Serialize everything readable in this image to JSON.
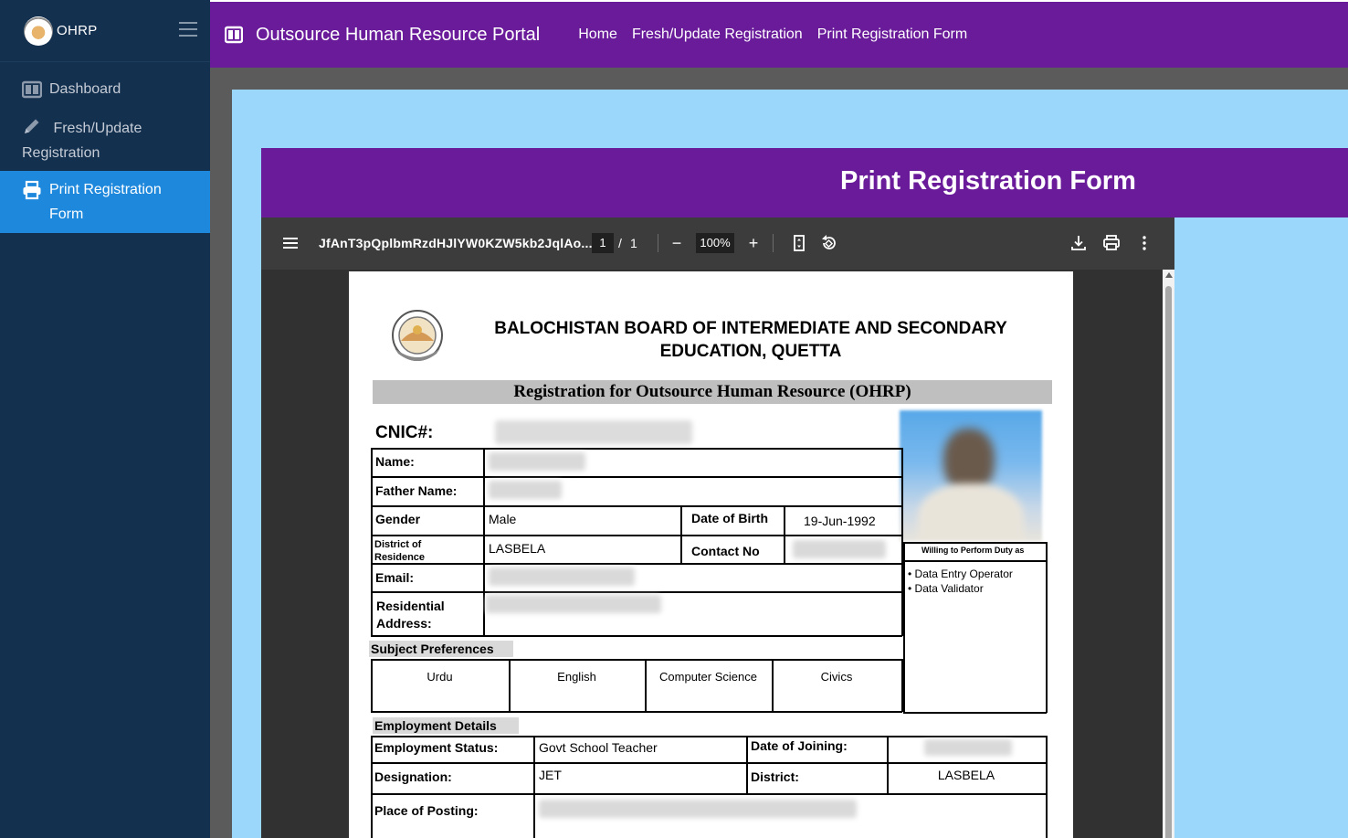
{
  "sidebar": {
    "brand": "OHRP",
    "items": [
      {
        "label": "Dashboard",
        "icon": "dashboard-icon"
      },
      {
        "label": "Fresh/Update",
        "label2": "Registration",
        "icon": "pencil-icon"
      },
      {
        "label": "Print Registration Form",
        "icon": "printer-icon"
      }
    ]
  },
  "topbar": {
    "title": "Outsource Human Resource Portal",
    "nav": [
      "Home",
      "Fresh/Update Registration",
      "Print Registration Form"
    ]
  },
  "form_header": {
    "title": "Print Registration Form"
  },
  "viewer": {
    "filename": "JfAnT3pQplbmRzdHJlYW0KZW5kb2JqlAo...",
    "page": "1",
    "slash": "/",
    "total": "1",
    "zoom": "100%",
    "minus": "−",
    "plus": "+"
  },
  "document": {
    "board_line1": "BALOCHISTAN BOARD OF INTERMEDIATE AND SECONDARY",
    "board_line2": "EDUCATION, QUETTA",
    "registration_title": "Registration for Outsource Human Resource (OHRP)",
    "cnic_label": "CNIC#:",
    "name_label": "Name:",
    "father_label": "Father Name:",
    "gender_label": "Gender",
    "gender_value": "Male",
    "dob_label": "Date of Birth",
    "dob_value": "19-Jun-1992",
    "district_label1": "District of",
    "district_label2": "Residence",
    "district_value": "LASBELA",
    "contact_label": "Contact No",
    "email_label": "Email:",
    "address_label1": "Residential",
    "address_label2": "Address:",
    "willing_label": "Willing to Perform Duty as",
    "duties": [
      "• Data Entry Operator",
      "• Data Validator"
    ],
    "subject_pref_label": "Subject Preferences",
    "subjects": [
      "Urdu",
      "English",
      "Computer Science",
      "Civics"
    ],
    "employment_label": "Employment Details",
    "emp_status_label": "Employment Status:",
    "emp_status_value": "Govt School Teacher",
    "doj_label": "Date of Joining:",
    "designation_label": "Designation:",
    "designation_value": "JET",
    "district2_label": "District:",
    "district2_value": "LASBELA",
    "posting_label": "Place of Posting:"
  },
  "colors": {
    "sidebar": "#14304f",
    "active": "#1e88dc",
    "topbar": "#6a1b9a",
    "card": "#9bd6fb",
    "viewer": "#313131"
  }
}
